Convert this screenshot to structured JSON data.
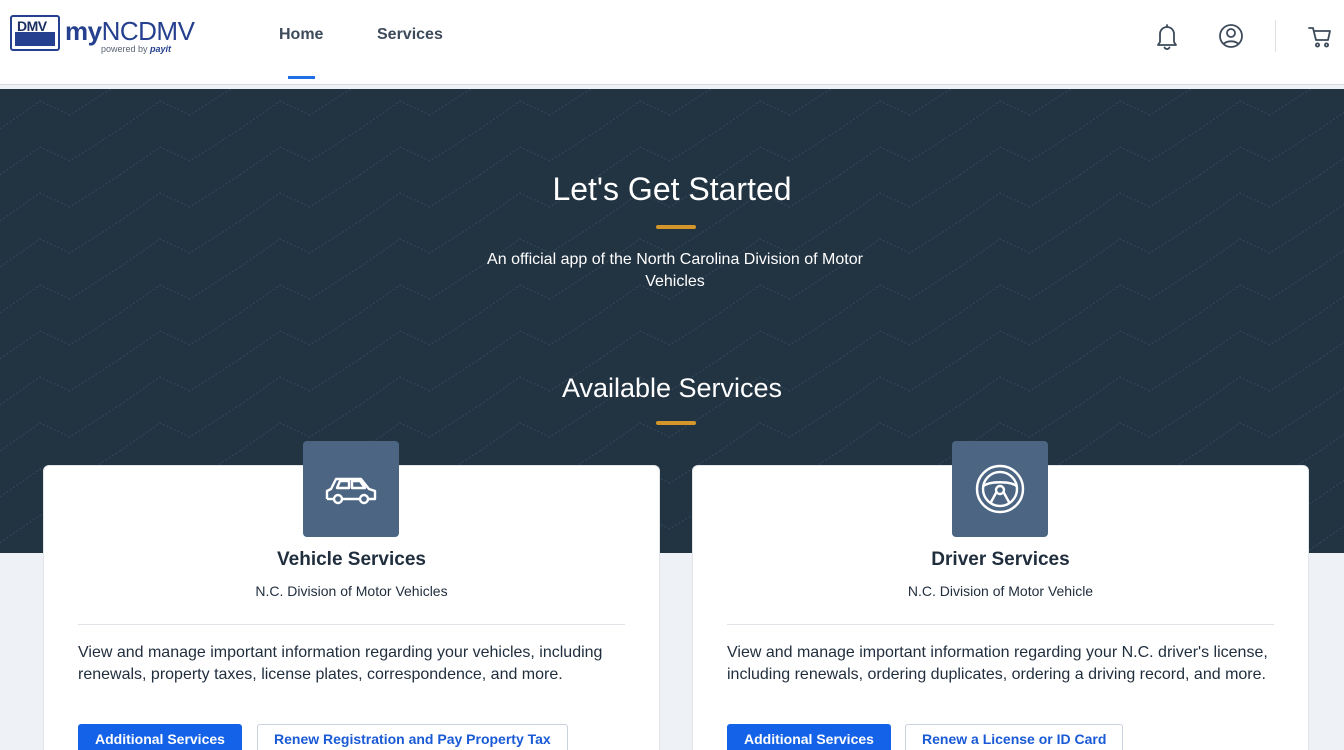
{
  "header": {
    "logo_badge": "DMV",
    "logo_word_bold": "my",
    "logo_word_rest": "NCDMV",
    "logo_powered_prefix": "powered by ",
    "logo_powered_brand": "payit",
    "nav": [
      {
        "label": "Home",
        "active": true
      },
      {
        "label": "Services",
        "active": false
      }
    ],
    "icons": [
      "bell-icon",
      "user-icon",
      "cart-icon"
    ]
  },
  "hero": {
    "title": "Let's Get Started",
    "subtitle": "An official app of the North Carolina Division of Motor Vehicles",
    "services_heading": "Available Services",
    "accent_color": "#d4952b",
    "background_color": "#223342"
  },
  "cards": [
    {
      "icon": "car-icon",
      "title": "Vehicle Services",
      "subtitle": "N.C. Division of Motor Vehicles",
      "description": "View and manage important information regarding your vehicles, including renewals, property taxes, license plates, correspondence, and more.",
      "primary_button": "Additional Services",
      "secondary_button": "Renew Registration and Pay Property Tax"
    },
    {
      "icon": "steering-wheel-icon",
      "title": "Driver Services",
      "subtitle": "N.C. Division of Motor Vehicle",
      "description": "View and manage important information regarding your N.C. driver's license, including renewals, ordering duplicates, ordering a driving record, and more.",
      "primary_button": "Additional Services",
      "secondary_button": "Renew a License or ID Card"
    }
  ],
  "colors": {
    "primary": "#1462e8",
    "icon_box": "#4b6583",
    "nav_indicator": "#1f6fe5"
  }
}
